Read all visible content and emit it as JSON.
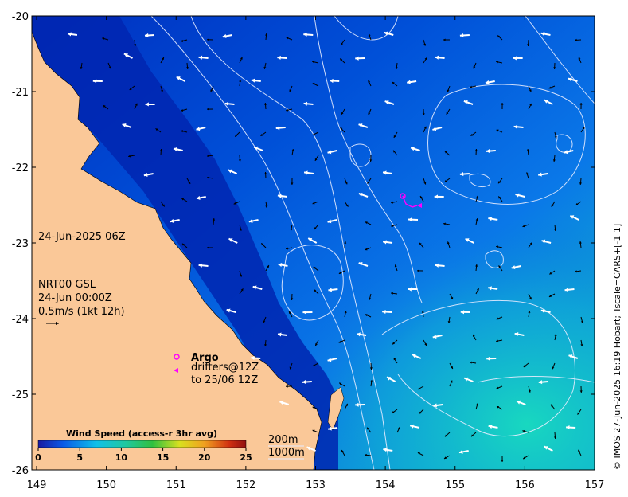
{
  "axes": {
    "x_ticks": [
      "149",
      "150",
      "151",
      "152",
      "153",
      "154",
      "155",
      "156",
      "157"
    ],
    "y_ticks": [
      "-20",
      "-21",
      "-22",
      "-23",
      "-24",
      "-25",
      "-26"
    ],
    "lon_range": [
      149,
      157
    ],
    "lat_range": [
      -26,
      -20
    ]
  },
  "annotations": {
    "map_time": "24-Jun-2025 06Z",
    "product": "NRT00 GSL",
    "product_time": "24-Jun 00:00Z",
    "vector_scale": "0.5m/s (1kt 12h)",
    "argo_label": "Argo",
    "drifters_label": "drifters@12Z",
    "drifters_to": "to 25/06 12Z",
    "contour_200": "200m",
    "contour_1000": "1000m",
    "credit": "© IMOS 27-Jun-2025 16:19 Hobart; Tscale=CARS+[-1 1]"
  },
  "colorbar": {
    "title": "Wind Speed (access-r 3hr avg)",
    "ticks": [
      "0",
      "5",
      "10",
      "15",
      "20",
      "25"
    ],
    "range": [
      0,
      25
    ]
  },
  "colors": {
    "land": "#FAC898",
    "deep_blue": "#0022A8",
    "mid_blue": "#0A5FE0",
    "teal": "#10C8C8",
    "argo": "#FF00FF",
    "contour": "#E6ECFF"
  },
  "markers": {
    "argo_symbol": "magenta-circle",
    "drifter_symbol": "magenta-triangle"
  }
}
